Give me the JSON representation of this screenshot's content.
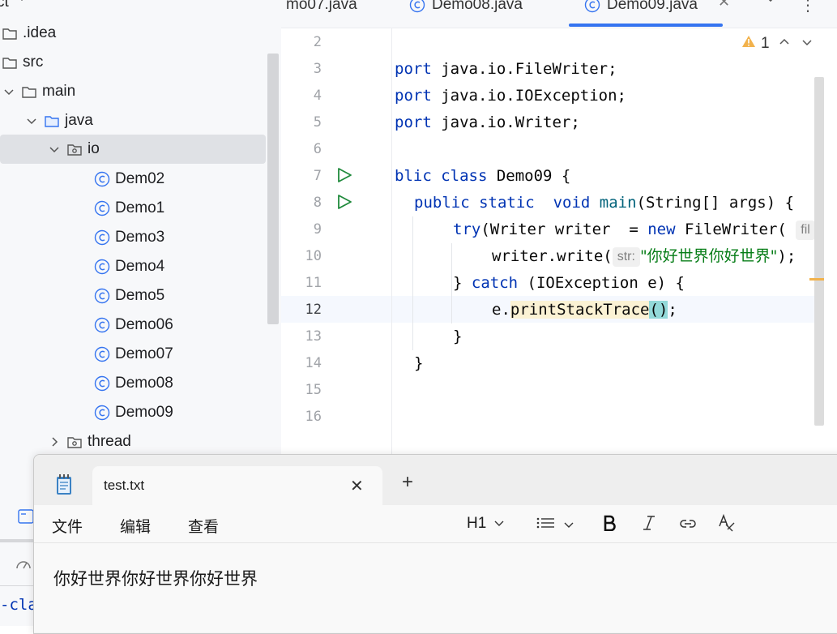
{
  "project_panel": {
    "title": "ct",
    "items": [
      {
        "label": ".idea",
        "kind": "folder"
      },
      {
        "label": "src",
        "kind": "folder"
      },
      {
        "label": "main",
        "kind": "folder",
        "expanded": true
      },
      {
        "label": "java",
        "kind": "source-folder",
        "expanded": true
      },
      {
        "label": "io",
        "kind": "package",
        "expanded": true,
        "selected": true
      },
      {
        "label": "Dem02",
        "kind": "class"
      },
      {
        "label": "Demo1",
        "kind": "class"
      },
      {
        "label": "Demo3",
        "kind": "class"
      },
      {
        "label": "Demo4",
        "kind": "class"
      },
      {
        "label": "Demo5",
        "kind": "class"
      },
      {
        "label": "Demo06",
        "kind": "class"
      },
      {
        "label": "Demo07",
        "kind": "class"
      },
      {
        "label": "Demo08",
        "kind": "class"
      },
      {
        "label": "Demo09",
        "kind": "class"
      },
      {
        "label": "thread",
        "kind": "package",
        "expanded": false
      }
    ]
  },
  "bottom_left": {
    "code_fragment": "-cla"
  },
  "editor_tabs": [
    {
      "label": "mo07.java",
      "active": false
    },
    {
      "label": "Demo08.java",
      "active": false
    },
    {
      "label": "Demo09.java",
      "active": true
    }
  ],
  "editor": {
    "warning_count": "1",
    "line_numbers": [
      "2",
      "3",
      "4",
      "5",
      "6",
      "7",
      "8",
      "9",
      "10",
      "11",
      "12",
      "13",
      "14",
      "15",
      "16"
    ],
    "current_line": "12",
    "code": {
      "l3": {
        "kw": "port",
        "rest": " java.io.FileWriter;"
      },
      "l4": {
        "kw": "port",
        "rest": " java.io.IOException;"
      },
      "l5": {
        "kw": "port",
        "rest": " java.io.Writer;"
      },
      "l7": {
        "kw": "blic class",
        "rest": " Demo09 {"
      },
      "l8": {
        "kw": "public static  void",
        "fn": " main",
        "rest": "(String[] args) {"
      },
      "l9": {
        "kw1": "try",
        "mid": "(Writer writer  = ",
        "kw2": "new",
        "rest": " FileWriter(",
        "hint": "fil"
      },
      "l10": {
        "pre": "writer.write(",
        "hint": "str:",
        "str": "\"你好世界你好世界\"",
        "post": ");"
      },
      "l11": {
        "pre": "} ",
        "kw": "catch",
        "rest": " (IOException e) {"
      },
      "l12": {
        "pre": "e.",
        "method": "printStackTrace",
        "paren": "()",
        "post": ";"
      },
      "l13": "}",
      "l14": "}"
    }
  },
  "notepad": {
    "tab_title": "test.txt",
    "new_tab": "+",
    "menus": [
      "文件",
      "编辑",
      "查看"
    ],
    "heading_select": "H1",
    "content": "你好世界你好世界你好世界"
  },
  "colors": {
    "accent": "#3574f0",
    "keyword": "#0033b3",
    "string": "#067d17",
    "run_green": "#208a3c"
  }
}
